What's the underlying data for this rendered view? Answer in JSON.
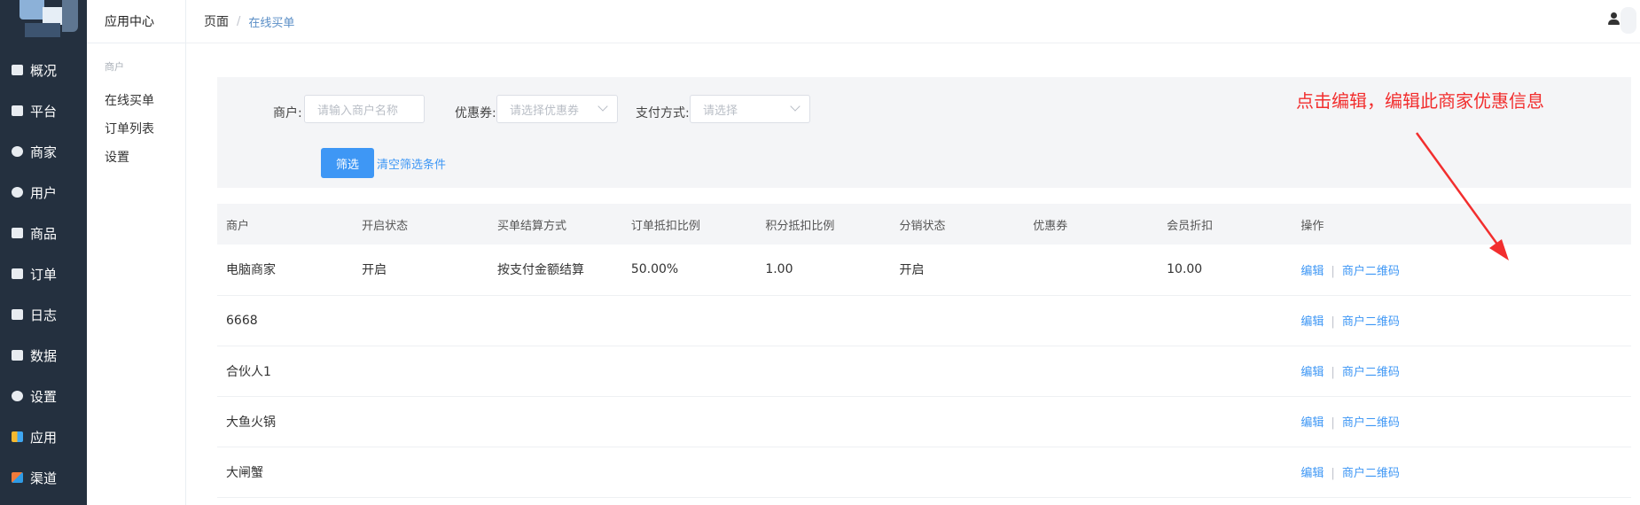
{
  "nav": {
    "items": [
      {
        "label": "概况",
        "icon": "monitor-icon"
      },
      {
        "label": "平台",
        "icon": "screen-icon"
      },
      {
        "label": "商家",
        "icon": "store-icon"
      },
      {
        "label": "用户",
        "icon": "user-icon"
      },
      {
        "label": "商品",
        "icon": "goods-icon"
      },
      {
        "label": "订单",
        "icon": "order-icon"
      },
      {
        "label": "日志",
        "icon": "log-icon"
      },
      {
        "label": "数据",
        "icon": "chart-icon"
      },
      {
        "label": "设置",
        "icon": "gear-icon"
      },
      {
        "label": "应用",
        "icon": "apps-icon"
      },
      {
        "label": "渠道",
        "icon": "cube-icon"
      }
    ]
  },
  "sub": {
    "title": "应用中心",
    "group": "商户",
    "items": [
      "在线买单",
      "订单列表",
      "设置"
    ]
  },
  "breadcrumb": {
    "root": "页面",
    "separator": "/",
    "current": "在线买单"
  },
  "filters": {
    "merchant_label": "商户:",
    "merchant_placeholder": "请输入商户名称",
    "coupon_label": "优惠券:",
    "coupon_placeholder": "请选择优惠券",
    "payment_label": "支付方式:",
    "payment_placeholder": "请选择",
    "filter_button": "筛选",
    "clear_link": "清空筛选条件"
  },
  "annotation": "点击编辑，编辑此商家优惠信息",
  "colors": {
    "accent": "#3e97f5",
    "nav_bg": "#24303f",
    "annotation": "#f22e2e"
  },
  "table": {
    "headers": [
      "商户",
      "开启状态",
      "买单结算方式",
      "订单抵扣比例",
      "积分抵扣比例",
      "分销状态",
      "优惠券",
      "会员折扣",
      "操作"
    ],
    "rows": [
      [
        "电脑商家",
        "开启",
        "按支付金额结算",
        "50.00%",
        "1.00",
        "开启",
        "",
        "10.00"
      ],
      [
        "6668",
        "",
        "",
        "",
        "",
        "",
        "",
        ""
      ],
      [
        "合伙人1",
        "",
        "",
        "",
        "",
        "",
        "",
        ""
      ],
      [
        "大鱼火锅",
        "",
        "",
        "",
        "",
        "",
        "",
        ""
      ],
      [
        "大闸蟹",
        "",
        "",
        "",
        "",
        "",
        "",
        ""
      ]
    ],
    "edit_label": "编辑",
    "op_separator": "|",
    "qr_label": "商户二维码"
  }
}
